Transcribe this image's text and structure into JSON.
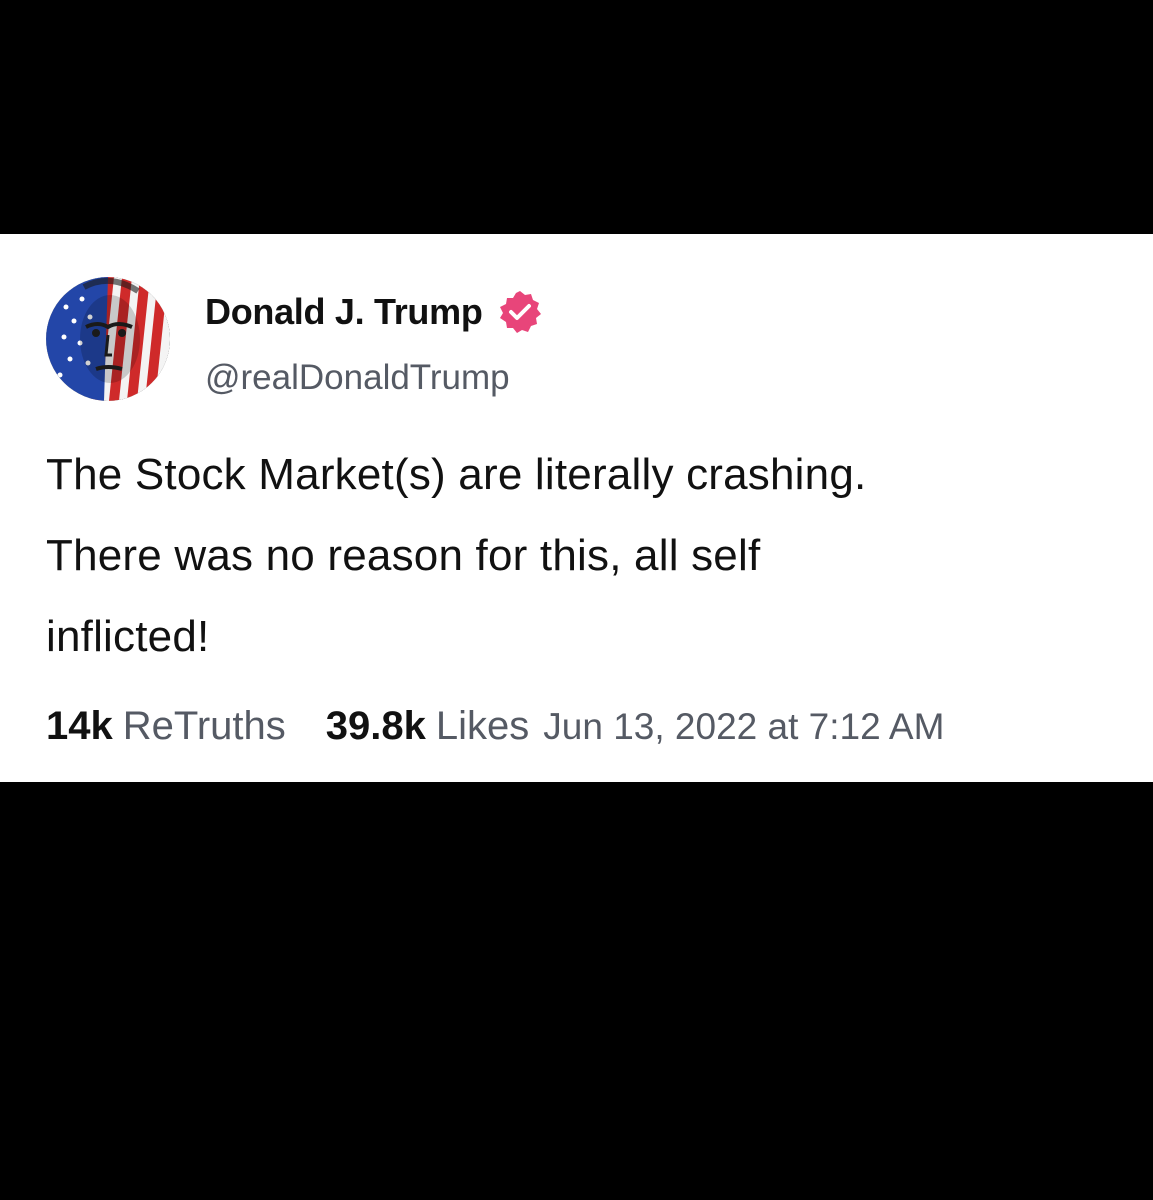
{
  "post": {
    "author": {
      "display_name": "Donald J. Trump",
      "handle": "@realDonaldTrump",
      "verified": true,
      "badge_color": "#e8457a",
      "avatar_icon": "flag-painted-face-avatar"
    },
    "body_lines": [
      "The Stock Market(s) are literally crashing.",
      "There was no reason for this, all self",
      "inflicted!"
    ],
    "stats": {
      "retruths_count": "14k",
      "retruths_label": "ReTruths",
      "likes_count": "39.8k",
      "likes_label": "Likes"
    },
    "timestamp": "Jun 13, 2022 at 7:12 AM"
  },
  "colors": {
    "background": "#000000",
    "card": "#ffffff",
    "primary_text": "#111111",
    "secondary_text": "#555a64",
    "badge": "#e8457a"
  }
}
